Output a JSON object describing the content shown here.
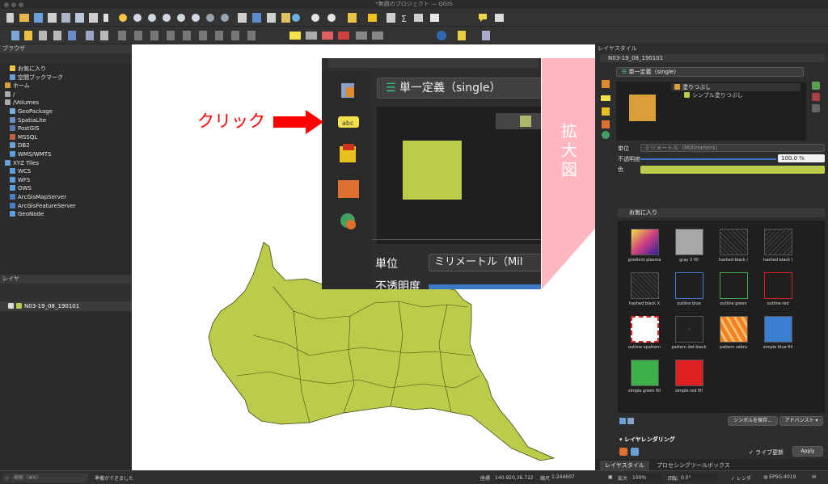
{
  "window": {
    "title": "*無題のプロジェクト — QGIS"
  },
  "browser": {
    "title": "ブラウザ",
    "items": [
      "お気に入り",
      "空間ブックマーク",
      "ホーム",
      "/",
      "/Volumes",
      "GeoPackage",
      "SpatiaLite",
      "PostGIS",
      "MSSQL",
      "DB2",
      "WMS/WMTS",
      "XYZ Tiles",
      "WCS",
      "WFS",
      "OWS",
      "ArcGisMapServer",
      "ArcGisFeatureServer",
      "GeoNode"
    ]
  },
  "layers": {
    "title": "レイヤ",
    "layer_name": "N03-19_08_190101"
  },
  "overlay": {
    "renderer": "単一定義（single）",
    "unit_label": "単位",
    "unit_value": "ミリメートル（Mil",
    "opacity_label": "不透明度",
    "layer_partial": "N03-19_08_190101"
  },
  "annotation": {
    "click": "クリック",
    "zoom_label": "拡大図",
    "red": "#ff0000"
  },
  "style_panel": {
    "title": "レイヤスタイル",
    "layer": "N03-19_08_190101",
    "renderer": "単一定義（single）",
    "tree_fill": "塗りつぶし",
    "tree_simple": "シンプル塗りつぶし",
    "unit_label": "単位",
    "unit_value": "ミリメートル（Millimeters）",
    "opacity_label": "不透明度",
    "opacity_value": "100.0 %",
    "color_label": "色",
    "favorites": "お気に入り",
    "symbols": [
      "gradient plasma",
      "gray 3 fill",
      "hashed black /",
      "hashed black \\",
      "hashed black X",
      "outline blue",
      "outline green",
      "outline red",
      "outline xpattern",
      "pattern dot black",
      "pattern zebra",
      "simple blue fill",
      "simple green fill",
      "simple red fill"
    ],
    "save_symbol": "シンボルを保存...",
    "advanced": "アドバンスト ▾",
    "layer_rendering": "レイヤレンダリング",
    "live_update": "ライブ更新",
    "apply": "Apply",
    "tab_style": "レイヤスタイル",
    "tab_processing": "プロセシングツールボックス"
  },
  "status": {
    "search_placeholder": "検索（⌘K）",
    "message": "準備ができました",
    "coord_label": "座標",
    "coord_value": "140.920,36.722",
    "scale_label": "縮尺",
    "scale_value": "1:244607",
    "zoom_label": "拡大",
    "zoom_value": "100%",
    "rotation_label": "回転",
    "rotation_value": "0.0°",
    "render_label": "レンダ",
    "crs": "EPSG:4019"
  },
  "colors": {
    "fill": "#bccc4a",
    "selection": "#f0a030"
  }
}
